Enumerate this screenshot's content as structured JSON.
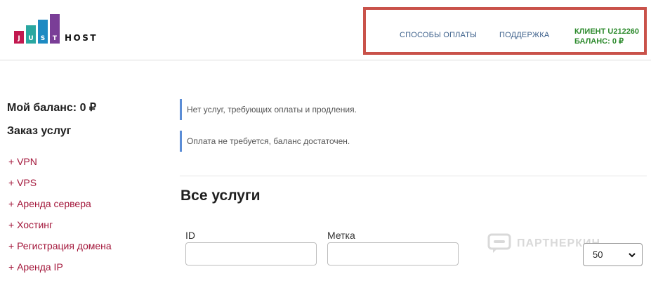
{
  "brand": {
    "letters": [
      "J",
      "U",
      "S",
      "T"
    ],
    "bar_colors": [
      "#c2184f",
      "#2aa7a0",
      "#1d8ac2",
      "#7a3e97"
    ],
    "host_text": "HOST"
  },
  "header": {
    "nav": [
      "СПОСОБЫ ОПЛАТЫ",
      "ПОДДЕРЖКА"
    ],
    "client_id": "КЛИЕНТ U212260",
    "client_balance": "БАЛАНС: 0 ₽",
    "highlight_color": "#c9524a"
  },
  "sidebar": {
    "balance": "Мой баланс: 0 ₽",
    "order_title": "Заказ услуг",
    "items": [
      "+ VPN",
      "+ VPS",
      "+ Аренда сервера",
      "+ Хостинг",
      "+ Регистрация домена",
      "+ Аренда IP"
    ]
  },
  "notices": [
    "Нет услуг, требующих оплаты и продления.",
    "Оплата не требуется, баланс достаточен."
  ],
  "services": {
    "title": "Все услуги",
    "filters": {
      "id_label": "ID",
      "id_value": "",
      "tag_label": "Метка",
      "tag_value": ""
    },
    "per_page": "50"
  },
  "watermark": "ПАРТНЕРКИН",
  "colors": {
    "sidebar_link": "#a3163a",
    "nav_link": "#3b5f8a",
    "client": "#2e8b2e",
    "notice_border": "#5b8dd6"
  }
}
